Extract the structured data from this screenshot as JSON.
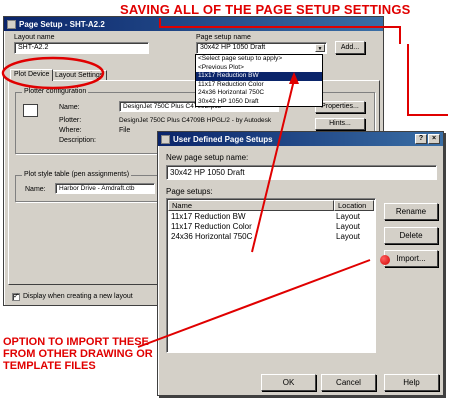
{
  "headline": "SAVING ALL OF THE PAGE SETUP SETTINGS",
  "page_setup": {
    "title": "Page Setup - SHT-A2.2",
    "layout_name_label": "Layout name",
    "layout_name_value": "SHT-A2.2",
    "page_setup_name_label": "Page setup name",
    "page_setup_name_value": "30x42 HP 1050 Draft",
    "add_button": "Add...",
    "tabs": [
      "Plot Device",
      "Layout Settings"
    ],
    "dropdown_options": [
      "<Select page setup to apply>",
      "<Previous Plot>",
      "11x17 Reduction BW",
      "11x17 Reduction Color",
      "24x36 Horizontal 750C",
      "30x42 HP 1050 Draft"
    ],
    "plotter_config": {
      "title": "Plotter configuration",
      "name_label": "Name:",
      "name_value": "DesignJet 750C Plus C4709B.pc3",
      "plotter_label": "Plotter:",
      "plotter_value": "DesignJet 750C Plus C4709B HPGL/2 - by Autodesk",
      "where_label": "Where:",
      "where_value": "File",
      "description_label": "Description:",
      "properties_button": "Properties...",
      "hints_button": "Hints..."
    },
    "plot_style": {
      "title": "Plot style table (pen assignments)",
      "name_label": "Name:",
      "name_value": "Harbor Drive - Amdraft.ctb"
    },
    "display_checkbox_label": "Display when creating a new layout"
  },
  "user_dialog": {
    "title": "User Defined Page Setups",
    "new_name_label": "New page setup name:",
    "new_name_value": "30x42 HP 1050 Draft",
    "page_setups_label": "Page setups:",
    "columns": [
      "Name",
      "Location"
    ],
    "rows": [
      {
        "name": "11x17 Reduction BW",
        "location": "Layout"
      },
      {
        "name": "11x17 Reduction Color",
        "location": "Layout"
      },
      {
        "name": "24x36 Horizontal 750C",
        "location": "Layout"
      }
    ],
    "buttons": {
      "rename": "Rename",
      "delete": "Delete",
      "import": "Import...",
      "ok": "OK",
      "cancel": "Cancel",
      "help": "Help"
    }
  },
  "callout": "OPTION TO IMPORT THESE FROM OTHER DRAWING OR TEMPLATE FILES",
  "colors": {
    "annotation_red": "#e00000",
    "title_bar": "#0a246a",
    "dialog_face": "#d4d0c8"
  }
}
